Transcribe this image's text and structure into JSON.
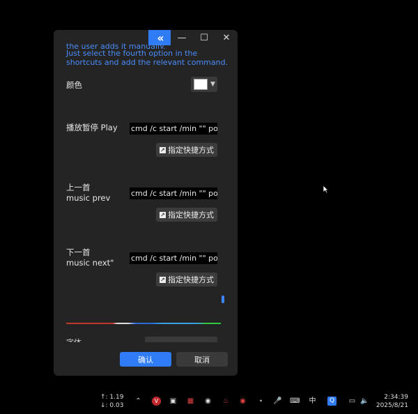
{
  "window": {
    "collapse_icon": "double-chevron-left-icon",
    "minimize_icon": "minimize-icon",
    "maximize_icon": "maximize-icon",
    "close_icon": "close-icon"
  },
  "note": {
    "line_cut": "the user adds it manually.",
    "line1": "Just select the fourth option in the",
    "line2": "shortcuts and add the relevant command."
  },
  "color_setting": {
    "label": "颜色",
    "swatch_color": "#ffffff"
  },
  "entries": [
    {
      "label_cn": "播放暂停 Play",
      "label_en": "",
      "command": "cmd /c start /min \"\" pow",
      "shortcut_label": "指定快捷方式"
    },
    {
      "label_cn": "上一首",
      "label_en": "music prev",
      "command": "cmd /c start /min \"\" pow",
      "shortcut_label": "指定快捷方式"
    },
    {
      "label_cn": "下一首",
      "label_en": "music next\"",
      "command": "cmd /c start /min \"\" pow",
      "shortcut_label": "指定快捷方式"
    }
  ],
  "footer": {
    "confirm_label": "确认",
    "cancel_label": "取消",
    "cut_label": "字体"
  },
  "taskbar": {
    "upload": "↑: 1.19",
    "download": "↓: 0.03",
    "ime": "中",
    "time": "2:34:39",
    "date": "2025/8/21"
  },
  "colors": {
    "accent": "#2f7cf6",
    "note_text": "#4b8df8",
    "panel_bg": "#242424"
  }
}
